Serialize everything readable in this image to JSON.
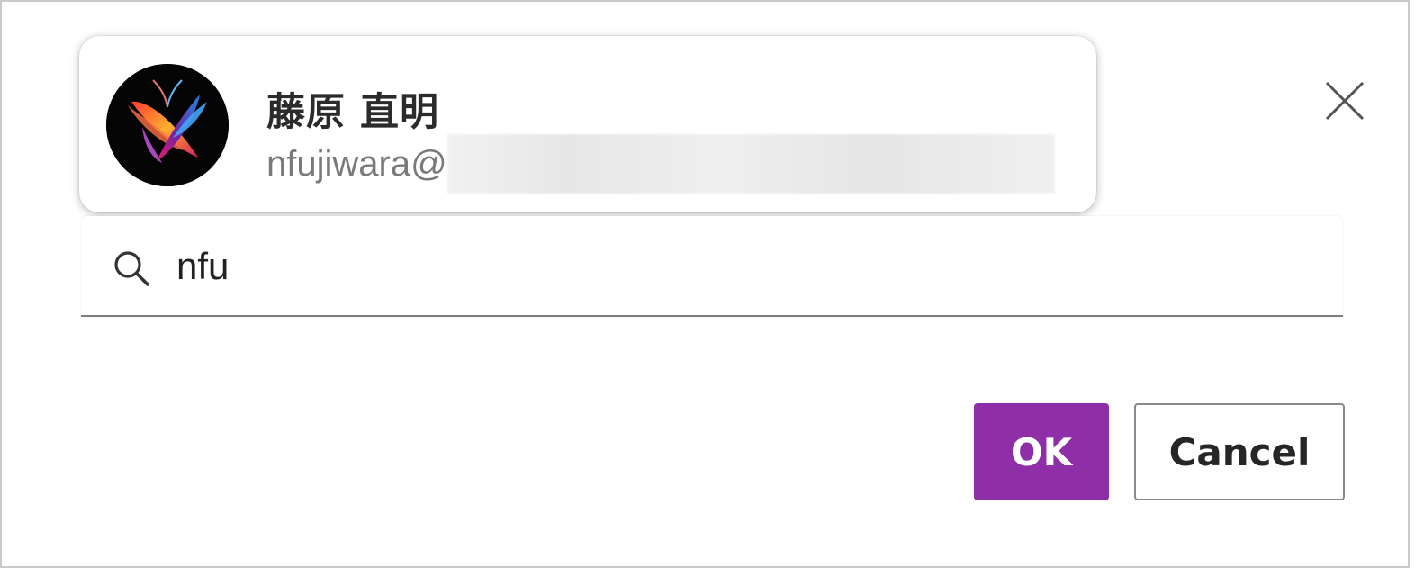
{
  "suggestion": {
    "name": "藤原 直明",
    "email_visible": "nfujiwara@"
  },
  "search": {
    "value": "nfu",
    "icon": "search-icon"
  },
  "close": {
    "icon": "close-icon"
  },
  "buttons": {
    "ok_label": "OK",
    "cancel_label": "Cancel"
  },
  "colors": {
    "primary": "#8e2fa8",
    "text": "#2b2b2b",
    "muted": "#7a7a7a"
  }
}
